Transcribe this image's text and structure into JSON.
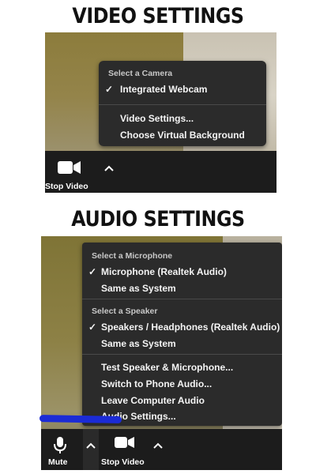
{
  "video": {
    "heading": "VIDEO SETTINGS",
    "menu": {
      "section_title": "Select a Camera",
      "selected_camera": "Integrated Webcam",
      "items": [
        "Video Settings...",
        "Choose Virtual Background"
      ]
    },
    "toolbar": {
      "stop_video_label": "Stop Video"
    }
  },
  "audio": {
    "heading": "AUDIO SETTINGS",
    "menu": {
      "microphone_title": "Select a Microphone",
      "microphones": [
        "Microphone (Realtek Audio)",
        "Same as System"
      ],
      "speaker_title": "Select a Speaker",
      "speakers": [
        "Speakers / Headphones (Realtek Audio)",
        "Same as System"
      ],
      "actions": [
        "Test Speaker & Microphone...",
        "Switch to Phone Audio...",
        "Leave Computer Audio",
        "Audio Settings..."
      ]
    },
    "toolbar": {
      "mute_label": "Mute",
      "stop_video_label": "Stop Video"
    }
  },
  "check_glyph": "✓",
  "colors": {
    "menu_bg": "#2b2b2b",
    "toolbar_bg": "#1c1c1c",
    "annotation_blue": "#1b2bd6"
  }
}
